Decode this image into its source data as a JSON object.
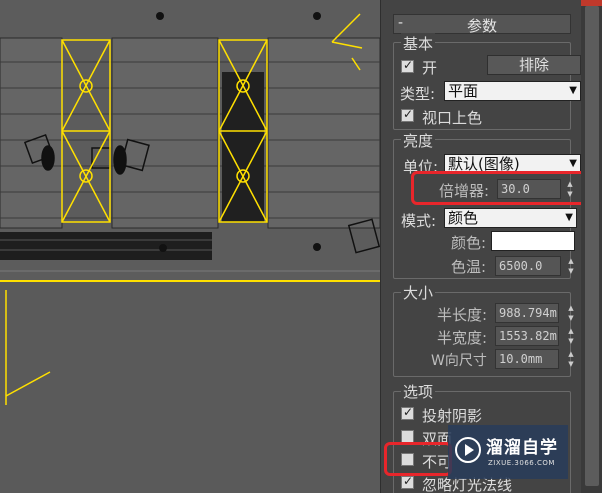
{
  "rollout": {
    "collapse_symbol": "-",
    "title": "参数"
  },
  "basic": {
    "label": "基本",
    "on_label": "开",
    "on_checked": true,
    "exclude_button": "排除",
    "type_label": "类型:",
    "type_value": "平面",
    "viewport_shading_label": "视口上色",
    "viewport_shading_checked": true
  },
  "brightness": {
    "label": "亮度",
    "unit_label": "单位:",
    "unit_value": "默认(图像)",
    "multiplier_label": "倍增器:",
    "multiplier_value": "30.0",
    "mode_label": "模式:",
    "mode_value": "颜色",
    "color_label": "颜色:",
    "color_value": "#ffffff",
    "temperature_label": "色温:",
    "temperature_value": "6500.0"
  },
  "size": {
    "label": "大小",
    "half_length_label": "半长度:",
    "half_length_value": "988.794m",
    "half_width_label": "半宽度:",
    "half_width_value": "1553.82m",
    "w_size_label": "W向尺寸",
    "w_size_value": "10.0mm"
  },
  "options": {
    "label": "选项",
    "cast_shadows_label": "投射阴影",
    "cast_shadows_checked": true,
    "double_sided_label": "双面",
    "double_sided_checked": false,
    "invisible_label": "不可",
    "invisible_checked": false,
    "ignore_normals_label": "忽略灯光法线",
    "ignore_normals_checked": true
  },
  "watermark": {
    "title": "溜溜自学",
    "url": "ZIXUE.3066.COM"
  },
  "colors": {
    "highlight": "#e8262b",
    "light_outline": "#ffe000",
    "viewport_bg": "#5a5a5a",
    "panel_bg": "#444444"
  }
}
